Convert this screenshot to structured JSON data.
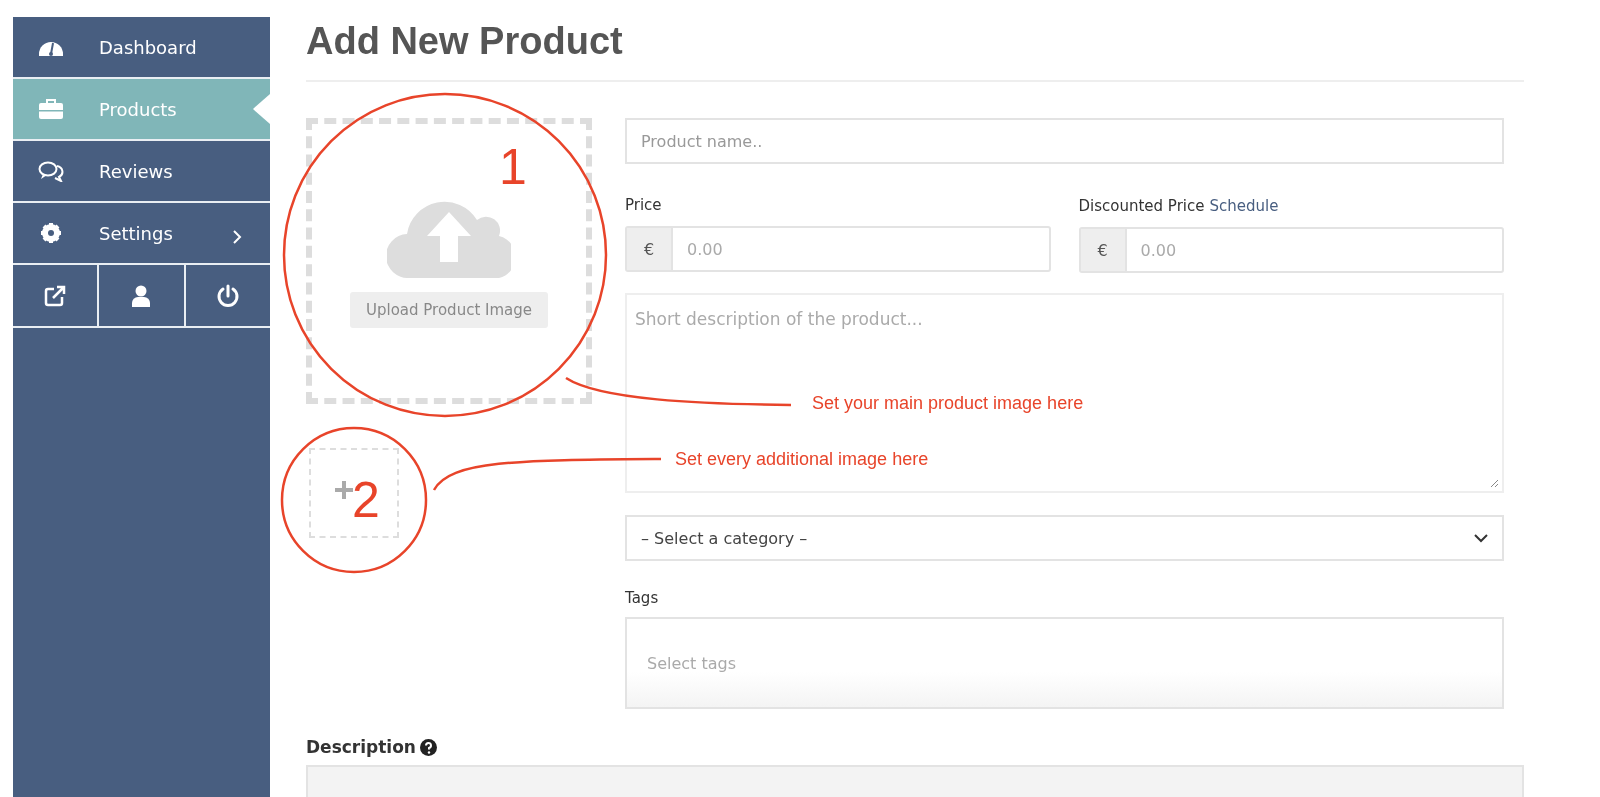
{
  "sidebar": {
    "items": [
      {
        "label": "Dashboard",
        "kind": "gauge",
        "selected": false,
        "submenu": false
      },
      {
        "label": "Products",
        "kind": "briefcase",
        "selected": true,
        "submenu": false
      },
      {
        "label": "Reviews",
        "kind": "comments",
        "selected": false,
        "submenu": false
      },
      {
        "label": "Settings",
        "kind": "gear",
        "selected": false,
        "submenu": true
      }
    ],
    "actions": [
      {
        "kind": "external"
      },
      {
        "kind": "user"
      },
      {
        "kind": "power"
      }
    ]
  },
  "page": {
    "title": "Add New Product"
  },
  "form": {
    "upload_button": "Upload Product Image",
    "product_name": {
      "placeholder": "Product name.."
    },
    "price": {
      "label": "Price",
      "currency": "€",
      "placeholder": "0.00"
    },
    "discounted_price": {
      "label": "Discounted Price",
      "link": "Schedule",
      "currency": "€",
      "placeholder": "0.00"
    },
    "short_description": {
      "placeholder": "Short description of the product..."
    },
    "category": {
      "value": "– Select a category –"
    },
    "tags": {
      "label": "Tags",
      "placeholder": "Select tags"
    },
    "description": {
      "label": "Description"
    }
  },
  "annotations": [
    {
      "kind": "main",
      "number": "1",
      "text": "Set your main product image here"
    },
    {
      "kind": "additional",
      "number": "2",
      "text": "Set every additional image here"
    }
  ]
}
